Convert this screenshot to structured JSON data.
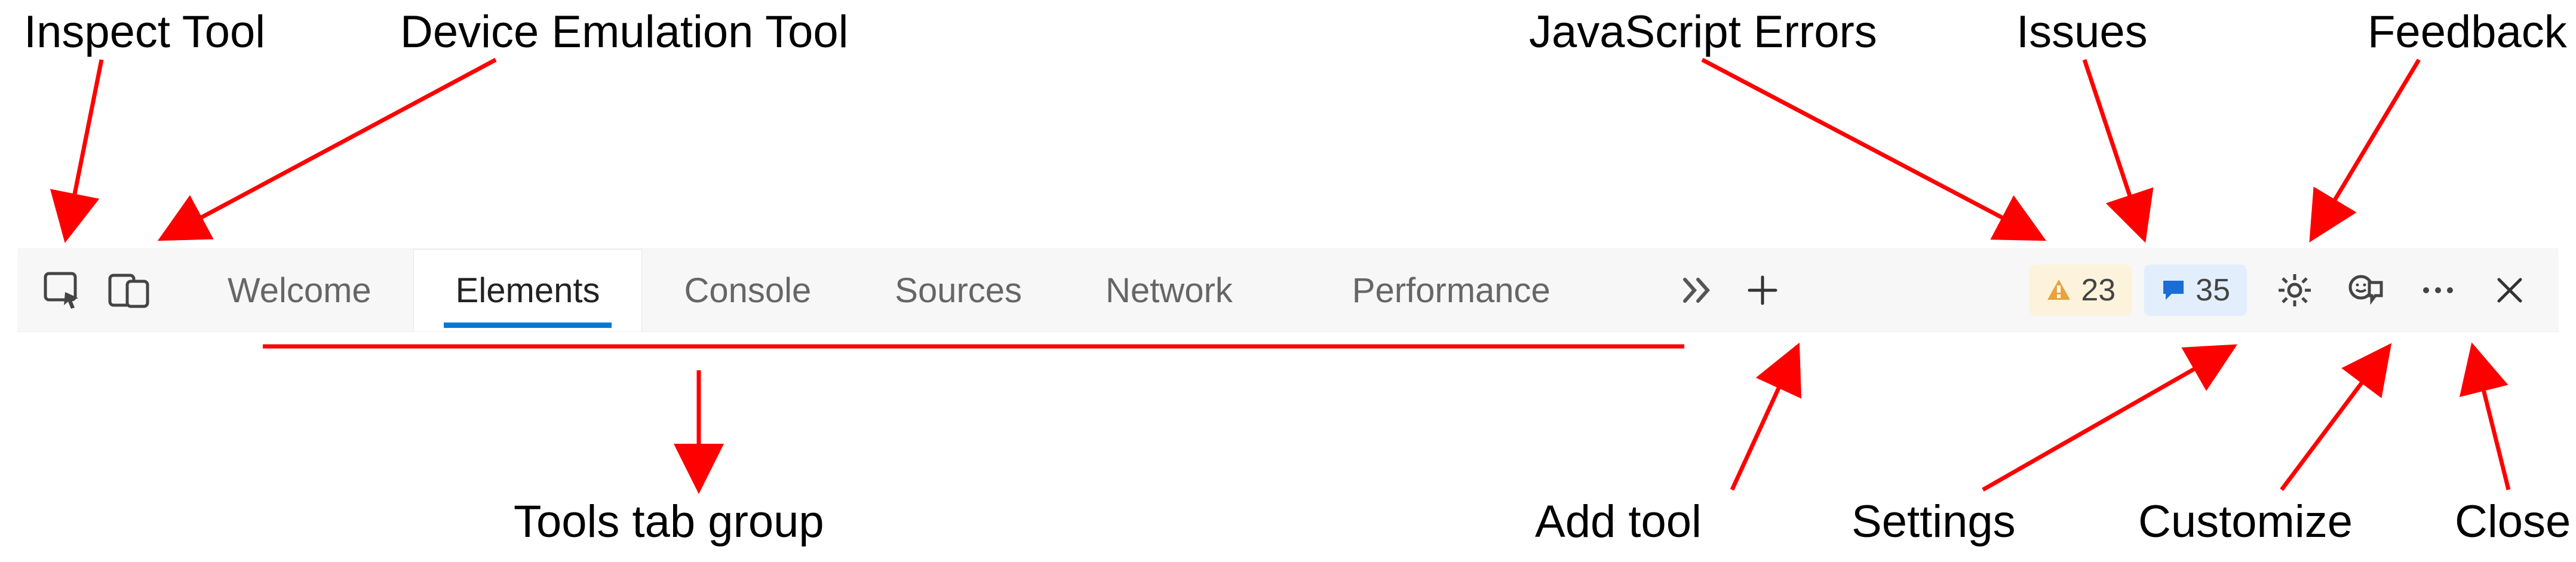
{
  "labels": {
    "top": {
      "inspect": "Inspect Tool",
      "device": "Device Emulation Tool",
      "jserrors": "JavaScript Errors",
      "issues": "Issues",
      "feedback": "Feedback"
    },
    "bottom": {
      "tabgroup": "Tools tab group",
      "addtool": "Add tool",
      "settings": "Settings",
      "customize": "Customize",
      "close": "Close"
    }
  },
  "toolbar": {
    "tabs": [
      {
        "label": "Welcome",
        "active": false
      },
      {
        "label": "Elements",
        "active": true
      },
      {
        "label": "Console",
        "active": false
      },
      {
        "label": "Sources",
        "active": false
      },
      {
        "label": "Network",
        "active": false
      },
      {
        "label": "Performance",
        "active": false
      }
    ],
    "errors_count": "23",
    "issues_count": "35"
  }
}
